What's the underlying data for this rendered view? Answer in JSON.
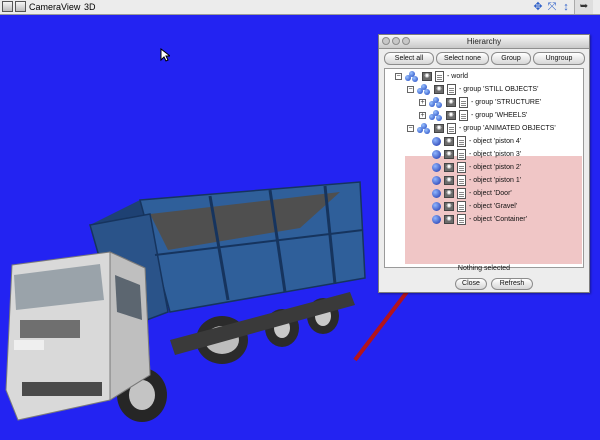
{
  "menubar": {
    "items": [
      "Camera",
      "View",
      "3D"
    ]
  },
  "hierarchy": {
    "title": "Hierarchy",
    "buttons": [
      "Select all",
      "Select none",
      "Group",
      "Ungroup"
    ],
    "rows": [
      "- world",
      "- group  'STILL OBJECTS'",
      "- group  'STRUCTURE'",
      "- group  'WHEELS'",
      "- group  'ANIMATED OBJECTS'",
      "- object  'piston 4'",
      "- object  'piston 3'",
      "- object  'piston 2'",
      "- object  'piston 1'",
      "- object  'Door'",
      "- object  'Gravel'",
      "- object  'Container'"
    ],
    "status": "Nothing selected",
    "close_label": "Close",
    "refresh_label": "Refresh"
  },
  "colors": {
    "viewport_bg": "#2323f2",
    "selection": "#f0c6c6",
    "arrow": "#b3141c",
    "truck_bed": "#2f5f9a"
  },
  "icons": [
    "app-icon",
    "move-icon",
    "rotate-icon",
    "scale-icon",
    "pointer-icon",
    "visibility-eye-icon",
    "properties-doc-icon",
    "group-icon",
    "object-sphere-icon"
  ]
}
